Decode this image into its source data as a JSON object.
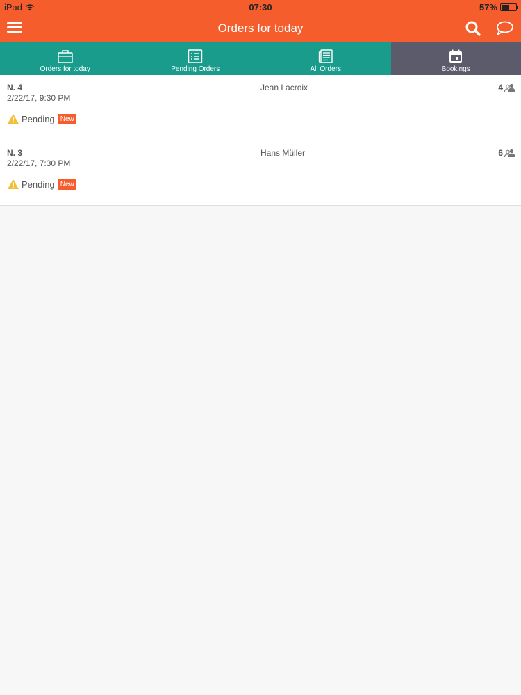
{
  "status_bar": {
    "device": "iPad",
    "time": "07:30",
    "battery": "57%",
    "battery_level": 0.57
  },
  "nav": {
    "title": "Orders for today",
    "icons": {
      "menu": "hamburger-menu-icon",
      "search": "search-icon",
      "chat": "chat-bubble-icon"
    }
  },
  "tabs": [
    {
      "label": "Orders for today",
      "icon": "briefcase-icon",
      "active": false
    },
    {
      "label": "Pending Orders",
      "icon": "list-icon",
      "active": false
    },
    {
      "label": "All Orders",
      "icon": "document-list-icon",
      "active": false
    },
    {
      "label": "Bookings",
      "icon": "calendar-icon",
      "active": true
    }
  ],
  "orders": [
    {
      "number": "N. 4",
      "date": "2/22/17, 9:30 PM",
      "customer": "Jean Lacroix",
      "guests": "4",
      "status": "Pending",
      "badge": "New"
    },
    {
      "number": "N. 3",
      "date": "2/22/17, 7:30 PM",
      "customer": "Hans Müller",
      "guests": "6",
      "status": "Pending",
      "badge": "New"
    }
  ],
  "colors": {
    "header": "#f55d2c",
    "tab_bar": "#1a9c8d",
    "tab_active": "#5b5b6b",
    "warning": "#f2c037"
  }
}
